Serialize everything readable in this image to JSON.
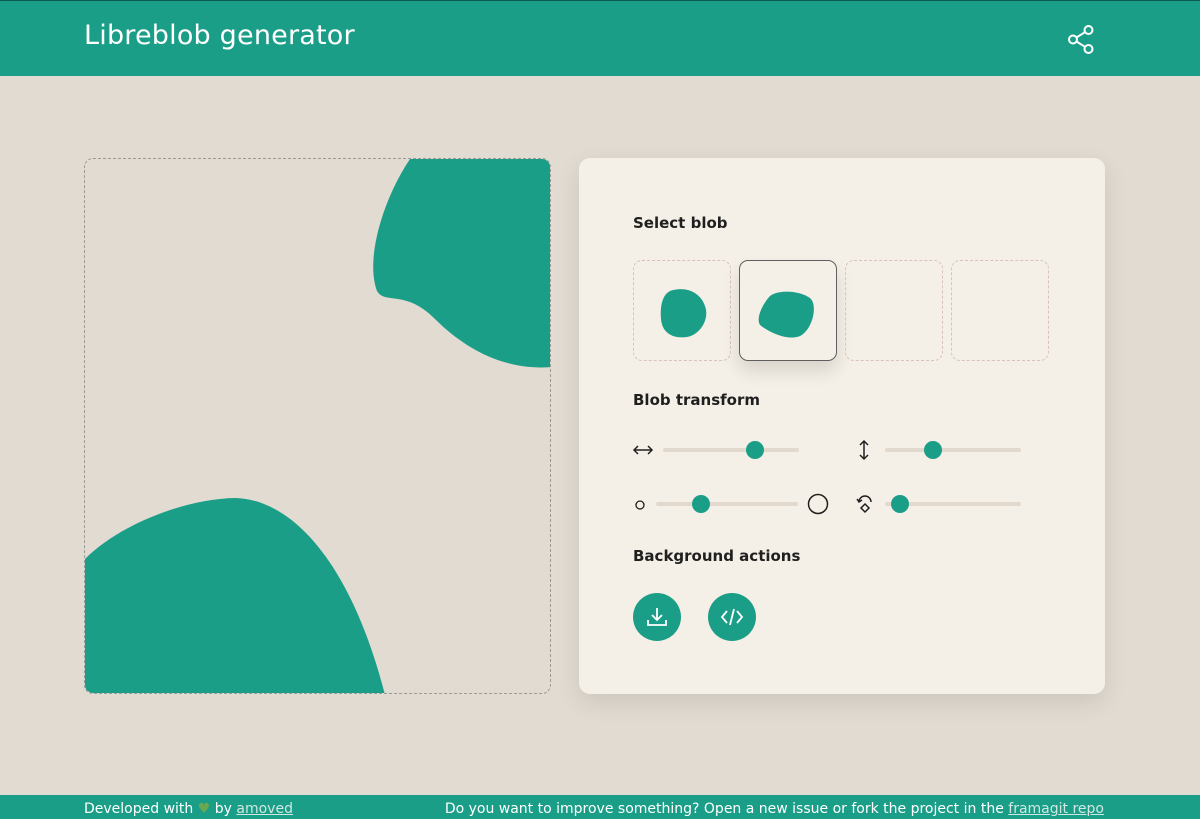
{
  "header": {
    "title": "Libreblob generator",
    "share_icon": "share-icon"
  },
  "colors": {
    "accent": "#1b9e88",
    "background": "#e2dbd1",
    "panel": "#f5f0e7"
  },
  "panel": {
    "select_blob_title": "Select blob",
    "blob_slots": [
      {
        "state": "filled",
        "selected": false
      },
      {
        "state": "filled",
        "selected": true
      },
      {
        "state": "empty",
        "selected": false
      },
      {
        "state": "empty",
        "selected": false
      }
    ],
    "blob_transform_title": "Blob transform",
    "sliders": {
      "width": {
        "icon": "horizontal-arrows-icon",
        "value": 0.7
      },
      "height": {
        "icon": "vertical-arrows-icon",
        "value": 0.33
      },
      "size": {
        "icon_min": "small-circle-icon",
        "icon_max": "large-circle-icon",
        "value": 0.29
      },
      "rotation": {
        "icon": "rotate-icon",
        "value": 0.05
      }
    },
    "background_actions_title": "Background actions",
    "actions": [
      {
        "icon": "download-icon"
      },
      {
        "icon": "code-icon"
      }
    ]
  },
  "footer": {
    "left_prefix": "Developed with",
    "heart": "♥",
    "left_by": "by",
    "author_link": "amoved",
    "right_text": "Do you want to improve something? Open a new issue or fork the project in the",
    "repo_link": "framagit repo"
  }
}
